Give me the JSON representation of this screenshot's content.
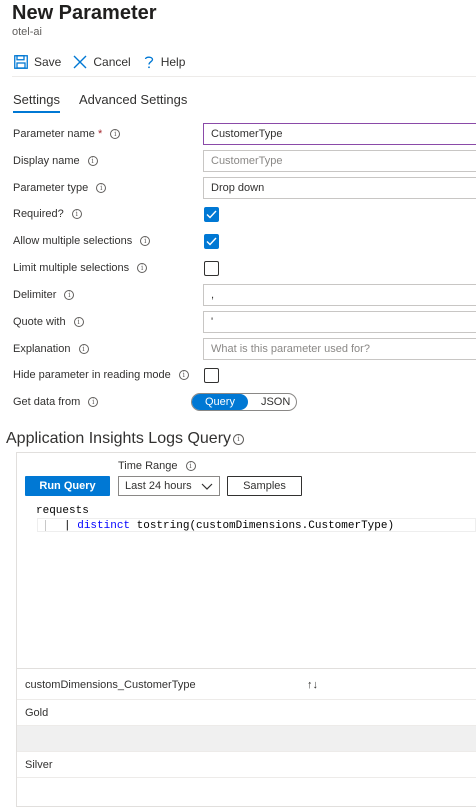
{
  "header": {
    "title": "New Parameter",
    "subtitle": "otel-ai"
  },
  "toolbar": {
    "save_label": "Save",
    "cancel_label": "Cancel",
    "help_label": "Help"
  },
  "tabs": [
    {
      "label": "Settings",
      "active": true
    },
    {
      "label": "Advanced Settings",
      "active": false
    }
  ],
  "form": {
    "parameter_name": {
      "label": "Parameter name",
      "required_mark": "*",
      "value": "CustomerType"
    },
    "display_name": {
      "label": "Display name",
      "placeholder": "CustomerType"
    },
    "parameter_type": {
      "label": "Parameter type",
      "value": "Drop down"
    },
    "required": {
      "label": "Required?",
      "checked": true
    },
    "allow_multiple": {
      "label": "Allow multiple selections",
      "checked": true
    },
    "limit_multiple": {
      "label": "Limit multiple selections",
      "checked": false
    },
    "delimiter": {
      "label": "Delimiter",
      "value": ","
    },
    "quote_with": {
      "label": "Quote with",
      "value": "'"
    },
    "explanation": {
      "label": "Explanation",
      "placeholder": "What is this parameter used for?"
    },
    "hide_in_reading": {
      "label": "Hide parameter in reading mode",
      "checked": false
    },
    "get_data_from": {
      "label": "Get data from",
      "options": [
        "Query",
        "JSON"
      ],
      "selected": "Query"
    }
  },
  "query_section": {
    "title": "Application Insights Logs Query",
    "time_range_label": "Time Range",
    "run_query_label": "Run Query",
    "time_range_value": "Last 24 hours",
    "samples_label": "Samples",
    "code": {
      "line1": "requests",
      "line2_pipe": "|",
      "line2_keyword": "distinct",
      "line2_rest": " tostring(customDimensions.CustomerType)"
    }
  },
  "results": {
    "column_header": "customDimensions_CustomerType",
    "sort_glyph": "↑↓",
    "rows": [
      "Gold",
      "",
      "Silver"
    ]
  },
  "colors": {
    "accent": "#0078d4",
    "required": "#a4262c",
    "focus_border": "#8a4aa8"
  }
}
